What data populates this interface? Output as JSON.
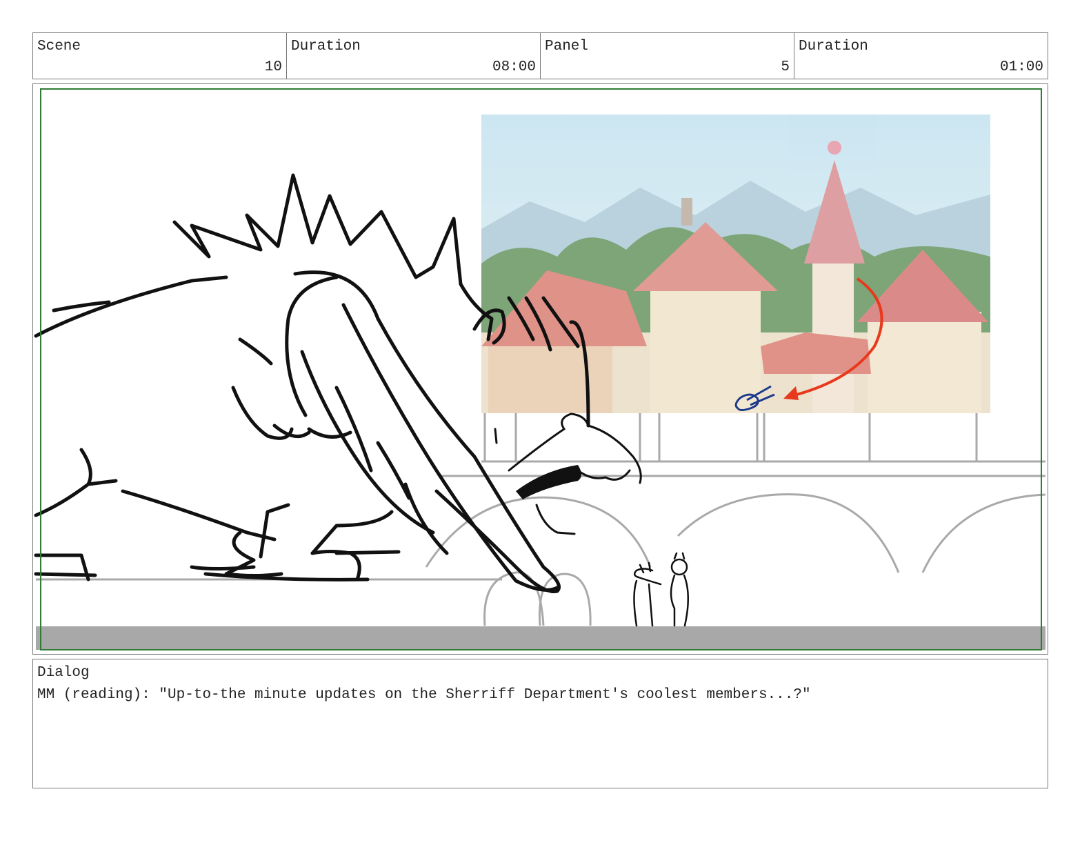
{
  "header": {
    "scene_label": "Scene",
    "scene_value": "10",
    "scene_duration_label": "Duration",
    "scene_duration_value": "08:00",
    "panel_label": "Panel",
    "panel_value": "5",
    "panel_duration_label": "Duration",
    "panel_duration_value": "01:00"
  },
  "panel": {
    "frame_color": "#2e7d32",
    "arrow_color": "#e8391c",
    "mark_color": "#1b3a8c"
  },
  "dialog": {
    "label": "Dialog",
    "text": "MM (reading): \"Up-to-the minute updates on the Sherriff Department's coolest members...?\""
  }
}
